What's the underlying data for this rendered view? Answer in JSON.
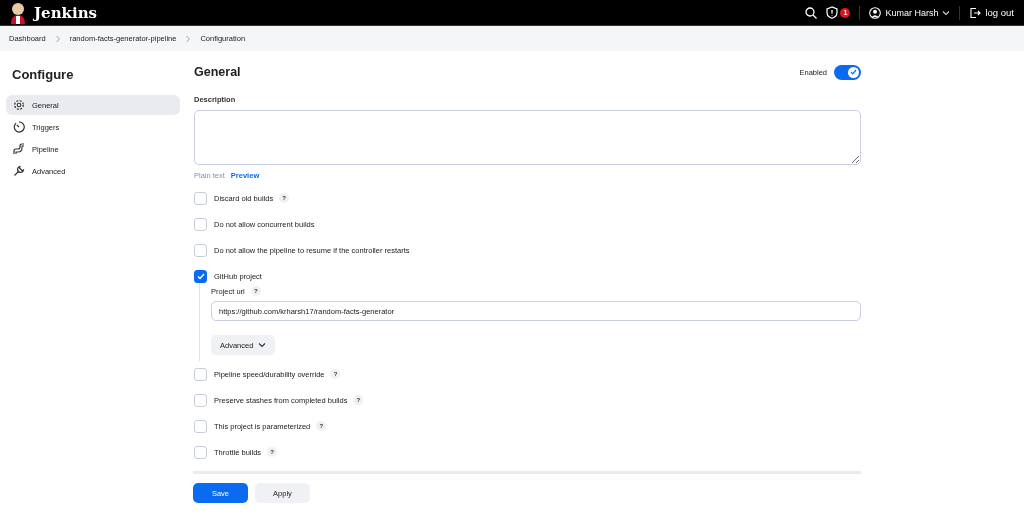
{
  "header": {
    "brand": "Jenkins",
    "alerts": "1",
    "user": "Kumar Harsh",
    "logout": "log out"
  },
  "breadcrumbs": [
    "Dashboard",
    "random-facts-generator-pipeline",
    "Configuration"
  ],
  "sidebar": {
    "title": "Configure",
    "items": [
      {
        "label": "General",
        "kind": "gear",
        "selected": true
      },
      {
        "label": "Triggers",
        "kind": "timer",
        "selected": false
      },
      {
        "label": "Pipeline",
        "kind": "pipe",
        "selected": false
      },
      {
        "label": "Advanced",
        "kind": "wrench",
        "selected": false
      }
    ]
  },
  "section": {
    "title": "General",
    "enabled_label": "Enabled",
    "enabled": true,
    "description_label": "Description",
    "format_links": [
      "Plain text",
      "Preview"
    ],
    "options": [
      {
        "label": "Discard old builds",
        "help": "?",
        "checked": false
      },
      {
        "label": "Do not allow concurrent builds",
        "checked": false
      },
      {
        "label": "Do not allow the pipeline to resume if the controller restarts",
        "checked": false
      },
      {
        "label": "GitHub project",
        "checked": true,
        "details": {
          "field_label": "Project url",
          "help": "?",
          "value": "https://github.com/krharsh17/random-facts-generator",
          "advanced": "Advanced"
        }
      },
      {
        "label": "Pipeline speed/durability override",
        "help": "?",
        "checked": false
      },
      {
        "label": "Preserve stashes from completed builds",
        "help": "?",
        "checked": false
      },
      {
        "label": "This project is parameterized",
        "help": "?",
        "checked": false
      },
      {
        "label": "Throttle builds",
        "help": "?",
        "checked": false
      }
    ]
  },
  "buttons": [
    {
      "label": "Save",
      "kind": "primary"
    },
    {
      "label": "Apply",
      "kind": "secondary"
    }
  ]
}
